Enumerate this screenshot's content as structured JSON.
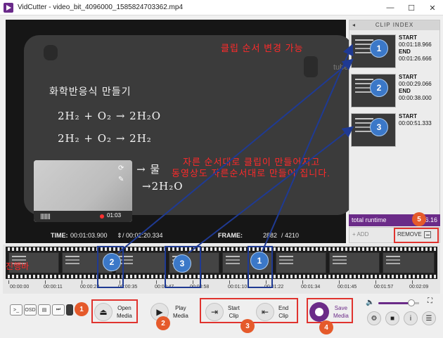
{
  "window": {
    "app_name": "VidCutter",
    "title": "VidCutter - video_bit_4096000_1585824703362.mp4",
    "controls": [
      "—",
      "☐",
      "✕"
    ]
  },
  "video": {
    "handwriting": [
      "화학반응식 만들기",
      "2H₂ + O₂ → 2H₂O",
      "2H₂ + O₂ → 2H₂",
      "수소 + 산소 → 물",
      "→2H₂O"
    ],
    "mini_player_time": "01:03",
    "watermark": "tube"
  },
  "status": {
    "time_label": "TIME:",
    "time_current": "00:01:03.900",
    "time_total": "/ 00:02:20.334",
    "frame_label": "FRAME:",
    "frame_current": "2882",
    "frame_total": "/ 4210"
  },
  "clip_index": {
    "header": "CLIP INDEX",
    "clips": [
      {
        "start_label": "START",
        "start": "00:01:18.966",
        "end_label": "END",
        "end": "00:01:26.666",
        "marker": "1"
      },
      {
        "start_label": "START",
        "start": "00:00:29.066",
        "end_label": "END",
        "end": "00:00:38.000",
        "marker": "2"
      },
      {
        "start_label": "START",
        "start": "00:00:51.333",
        "marker": "3"
      }
    ],
    "partial_end_time": "0:16",
    "total_label": "total runtime",
    "total_value": "6.16",
    "add_label": "+ ADD",
    "remove_label": "REMOVE"
  },
  "annotations": {
    "reorder_note": "클립 순서 변경 가능",
    "order_note_1": "자른 순서대로 클립이 만들어지고",
    "order_note_2": "동영상도 자른순서대로 만들어 집니다.",
    "progress_label": "진행바",
    "timeline_markers": [
      "2",
      "3",
      "1"
    ],
    "step_markers": [
      "1",
      "2",
      "3",
      "4",
      "5"
    ]
  },
  "timeline": {
    "ticks": [
      "00:00:00",
      "00:00:11",
      "00:00:23",
      "00:00:35",
      "00:00:47",
      "00:00:58",
      "00:01:10",
      "00:01:22",
      "00:01:34",
      "00:01:45",
      "00:01:57",
      "00:02:09"
    ]
  },
  "toolbar": {
    "console_label": ">_",
    "osd_label": "OSD",
    "open_media": "Open\nMedia",
    "play_media": "Play\nMedia",
    "start_clip": "Start\nClip",
    "end_clip": "End\nClip",
    "save_media": "Save\nMedia"
  },
  "colors": {
    "accent": "#6b2b88",
    "annotation_red": "#e0332e",
    "annotation_blue": "#1f3a93",
    "marker_orange": "#e55a2b",
    "marker_blue": "#3b78c8"
  }
}
